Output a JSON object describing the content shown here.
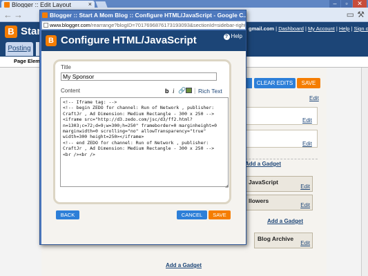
{
  "browser": {
    "tab_title": "Blogger :: Edit Layout",
    "tab_close": "×",
    "window_controls": [
      "–",
      "▫",
      "✕"
    ]
  },
  "blogger": {
    "logo_letter": "B",
    "blog_title": "Start",
    "user_email": "gmail.com",
    "nav": [
      "Dashboard",
      "My Account",
      "Help",
      "Sign out"
    ],
    "tab_posting": "Posting",
    "subnav_label": "Page Eleme",
    "buttons": {
      "clear_edits": "CLEAR EDITS",
      "save": "SAVE"
    },
    "edit_label": "Edit",
    "gadgets": [
      {
        "label": "JavaScript",
        "edit": "Edit"
      },
      {
        "label": "llowers",
        "edit": "Edit"
      },
      {
        "label": "Blog Archive",
        "edit": "Edit"
      }
    ],
    "add_gadget": "Add a Gadget"
  },
  "popup": {
    "window_title": "Blogger :: Start A Mom Blog :: Configure HTML/JavaScript - Google C...",
    "url_host": "www.blogger.com",
    "url_path": "/rearrange?blogID=7017696876173193093&sectionId=sidebar-right-1&action",
    "heading": "Configure HTML/JavaScript",
    "help": "Help",
    "form": {
      "title_label": "Title",
      "title_value": "My Sponsor",
      "content_label": "Content",
      "toolbar": {
        "bold": "b",
        "italic": "i",
        "separator": "|",
        "rich_text": "Rich Text"
      },
      "content_value": "<!-- Iframe tag: -->\n<!-- begin ZEDO for channel: Run of Network , publisher: CraftJr , Ad Dimension: Medium Rectangle - 300 x 250 -->\n<iframe src=\"http://d3.zedo.com/jsc/d3/ff2.html?n=1303;c=72;d=9;w=300;h=250\" frameborder=0 marginheight=0 marginwidth=0 scrolling=\"no\" allowTransparency=\"true\" width=300 height=250></iframe>\n<!-- end ZEDO for channel: Run of Network , publisher: CraftJr , Ad Dimension: Medium Rectangle - 300 x 250 -->\n<br /><br />"
    },
    "buttons": {
      "back": "BACK",
      "cancel": "CANCEL",
      "save": "SAVE"
    }
  },
  "colors": {
    "header_blue": "#1c4577",
    "button_blue": "#2d7fd8",
    "button_orange": "#f57d00",
    "window_blue": "#4e79be"
  }
}
